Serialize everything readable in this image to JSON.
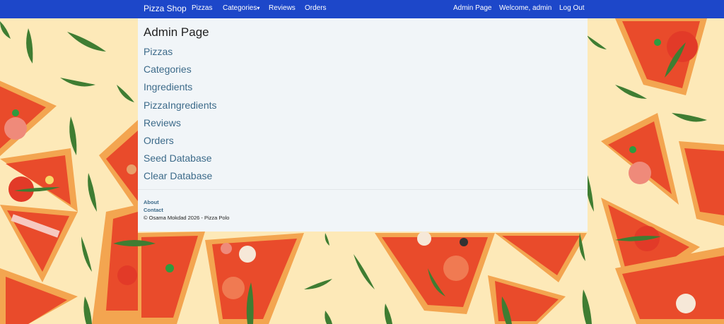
{
  "navbar": {
    "brand": "Pizza Shop",
    "links": [
      {
        "label": "Pizzas"
      },
      {
        "label": "Categories"
      },
      {
        "label": "Reviews"
      },
      {
        "label": "Orders"
      }
    ],
    "categories_caret": "▾",
    "right": {
      "admin_page": "Admin Page",
      "welcome": "Welcome, admin",
      "logout": "Log Out"
    }
  },
  "main": {
    "title": "Admin Page",
    "links": [
      "Pizzas",
      "Categories",
      "Ingredients",
      "PizzaIngredients",
      "Reviews",
      "Orders",
      "Seed Database",
      "Clear Database"
    ]
  },
  "footer": {
    "about": "About",
    "contact": "Contact",
    "copyright": "© Osama Mokdad 2026 - Pizza Polo"
  },
  "colors": {
    "navbar": "#1d47c9",
    "panel": "#f1f5f8",
    "link": "#3d6b8a",
    "background": "#fde9b8"
  }
}
